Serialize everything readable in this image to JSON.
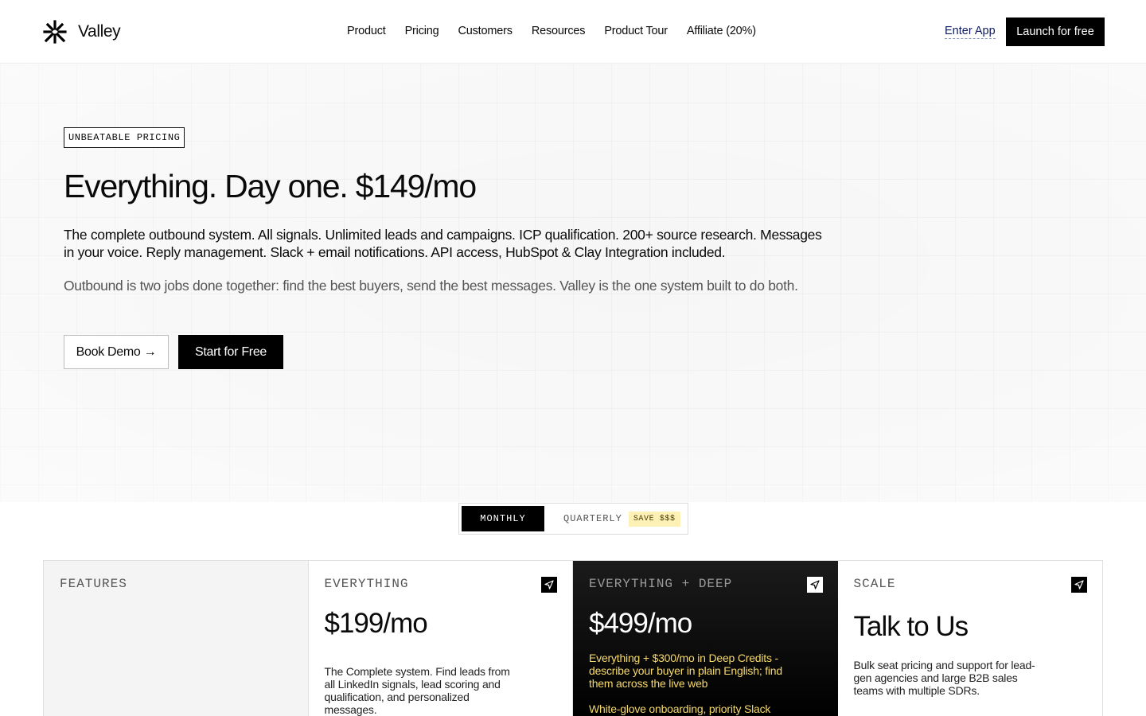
{
  "header": {
    "brand": "Valley",
    "nav": [
      "Product",
      "Pricing",
      "Customers",
      "Resources",
      "Product Tour",
      "Affiliate (20%)"
    ],
    "enter_app": "Enter App",
    "launch": "Launch for free"
  },
  "hero": {
    "badge": "UNBEATABLE PRICING",
    "title": "Everything. Day one. $149/mo",
    "description": "The complete outbound system. All signals. Unlimited leads and campaigns. ICP qualification. 200+ source research. Messages in your voice. Reply management. Slack + email notifications. API access, HubSpot & Clay Integration included.",
    "subtext": "Outbound is two jobs done together: find the best buyers, send the best messages. Valley is the one system built to do both.",
    "book_demo": "Book Demo →",
    "start_free": "Start for Free"
  },
  "billing_toggle": {
    "monthly": "MONTHLY",
    "quarterly": "QUARTERLY",
    "save_badge": "SAVE $$$",
    "selected": "MONTHLY"
  },
  "plans": {
    "features": {
      "label": "FEATURES"
    },
    "everything": {
      "label": "EVERYTHING",
      "price": "$199/mo",
      "description": "The Complete system. Find leads from all LinkedIn signals, lead scoring and qualification,  and personalized messages."
    },
    "deep": {
      "label": "EVERYTHING + DEEP",
      "price": "$499/mo",
      "highlight": "Everything + $300/mo in Deep Credits - describe your buyer in plain English; find them across the live web",
      "highlight2": "White-glove onboarding, priority Slack"
    },
    "scale": {
      "label": "SCALE",
      "title": "Talk to Us",
      "description": "Bulk seat pricing and support for lead-gen agencies and large B2B sales teams with multiple SDRs."
    }
  },
  "colors": {
    "accent_dark": "#000000",
    "highlight_yellow": "#f5d96b",
    "save_badge_bg": "#fdf1b6",
    "link_blue": "#0d1b5e"
  }
}
